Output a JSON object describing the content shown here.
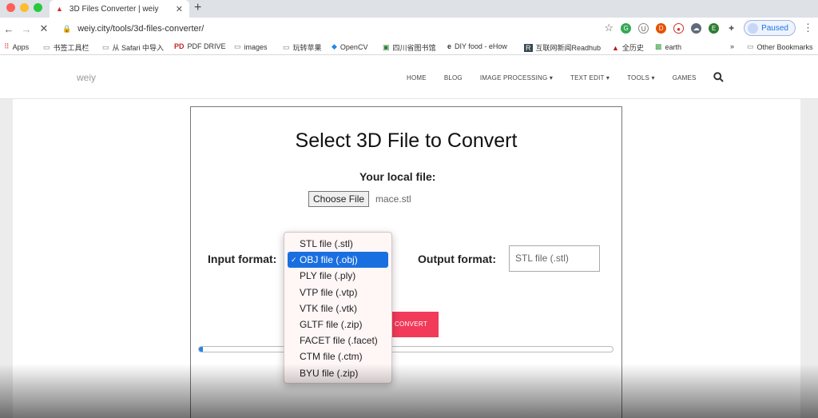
{
  "browser": {
    "tab_title": "3D Files Converter | weiy",
    "url": "weiy.city/tools/3d-files-converter/",
    "profile_label": "Paused",
    "bookmarks": [
      "Apps",
      "书签工具栏",
      "从 Safari 中导入",
      "PDF DRIVE",
      "images",
      "玩转苹果",
      "OpenCV",
      "四川省图书馆",
      "DIY food - eHow",
      "互联网新闻Readhub",
      "全历史",
      "earth",
      "»",
      "Other Bookmarks"
    ]
  },
  "site": {
    "logo": "weiy",
    "nav": [
      "HOME",
      "BLOG",
      "IMAGE PROCESSING ▾",
      "TEXT EDIT ▾",
      "TOOLS ▾",
      "GAMES"
    ]
  },
  "converter": {
    "heading": "Select 3D File to Convert",
    "local_file_label": "Your local file:",
    "choose_file_label": "Choose File",
    "file_name": "mace.stl",
    "input_format_label": "Input format:",
    "output_format_label": "Output format:",
    "output_selected": "STL file (.stl)",
    "convert_label": "CONVERT",
    "progress": 0.01
  },
  "dropdown": {
    "options": [
      "STL file (.stl)",
      "OBJ file (.obj)",
      "PLY file (.ply)",
      "VTP file (.vtp)",
      "VTK file (.vtk)",
      "GLTF file (.zip)",
      "FACET file (.facet)",
      "CTM file (.ctm)",
      "BYU file (.zip)"
    ],
    "selected_index": 1
  },
  "colors": {
    "accent": "#f23a5a",
    "selection": "#1a6fe0",
    "progress": "#1e88e5"
  }
}
